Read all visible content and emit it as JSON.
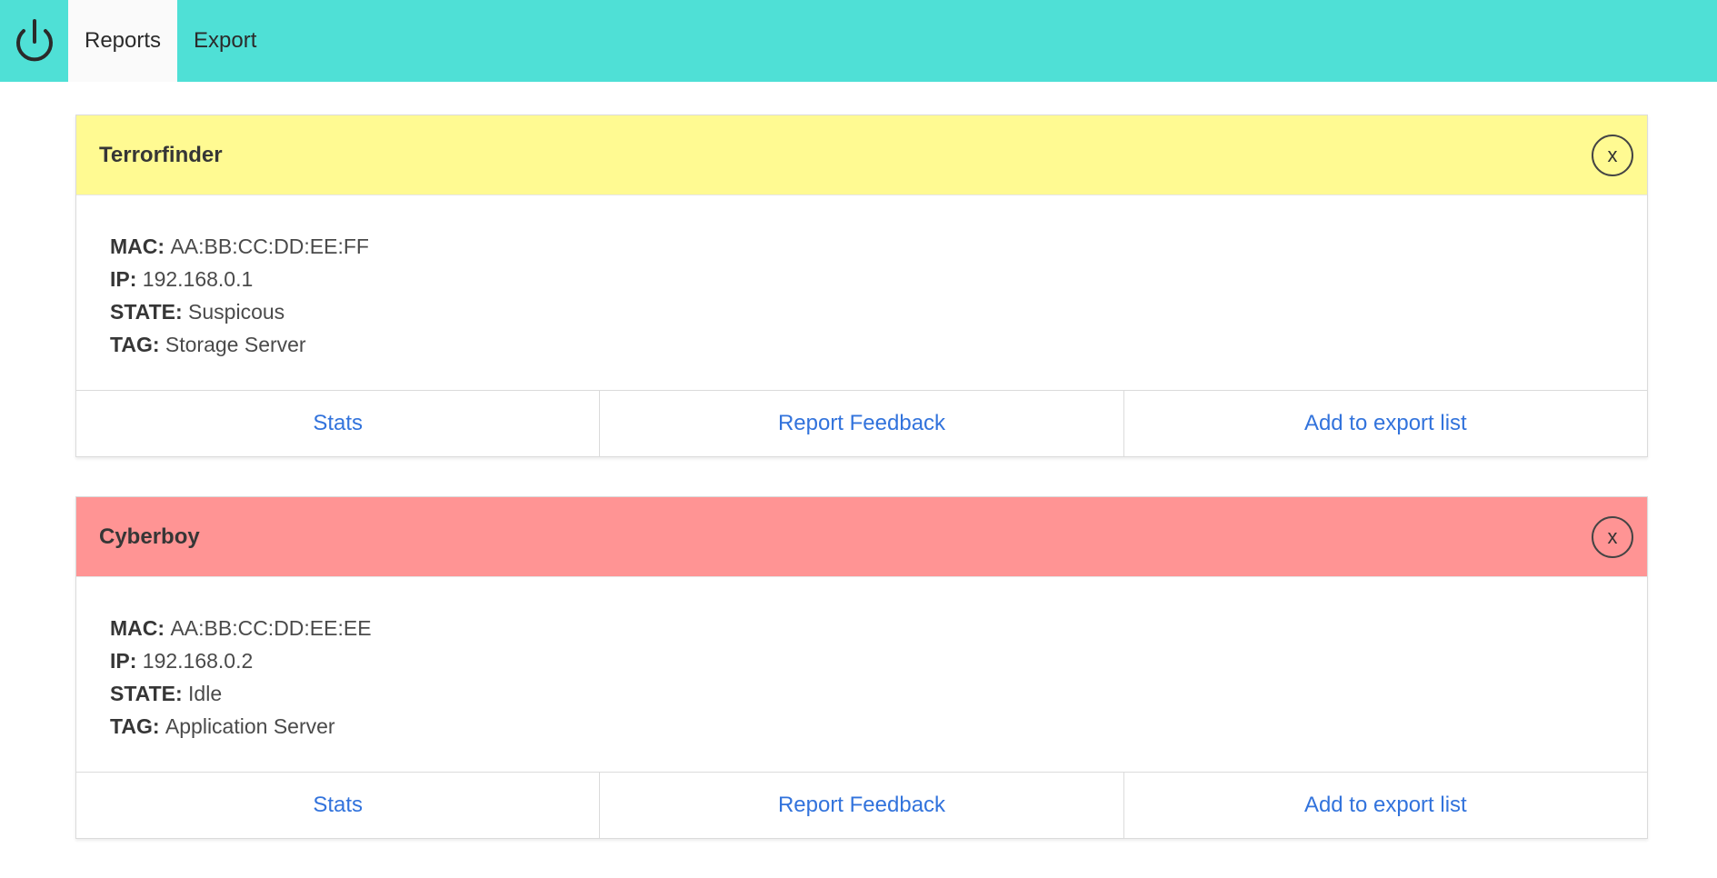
{
  "navbar": {
    "logo_icon": "power-icon",
    "items": [
      {
        "label": "Reports",
        "active": true
      },
      {
        "label": "Export",
        "active": false
      }
    ],
    "background": "#4fe0d6"
  },
  "cards": [
    {
      "title": "Terrorfinder",
      "header_color": "#fffa92",
      "close_label": "x",
      "fields": [
        {
          "label": "MAC:",
          "value": "AA:BB:CC:DD:EE:FF"
        },
        {
          "label": "IP:",
          "value": "192.168.0.1"
        },
        {
          "label": "STATE:",
          "value": "Suspicous"
        },
        {
          "label": "TAG:",
          "value": "Storage Server"
        }
      ],
      "actions": [
        "Stats",
        "Report Feedback",
        "Add to export list"
      ]
    },
    {
      "title": "Cyberboy",
      "header_color": "#ff9494",
      "close_label": "x",
      "fields": [
        {
          "label": "MAC:",
          "value": "AA:BB:CC:DD:EE:EE"
        },
        {
          "label": "IP:",
          "value": "192.168.0.2"
        },
        {
          "label": "STATE:",
          "value": "Idle"
        },
        {
          "label": "TAG:",
          "value": "Application Server"
        }
      ],
      "actions": [
        "Stats",
        "Report Feedback",
        "Add to export list"
      ]
    }
  ]
}
